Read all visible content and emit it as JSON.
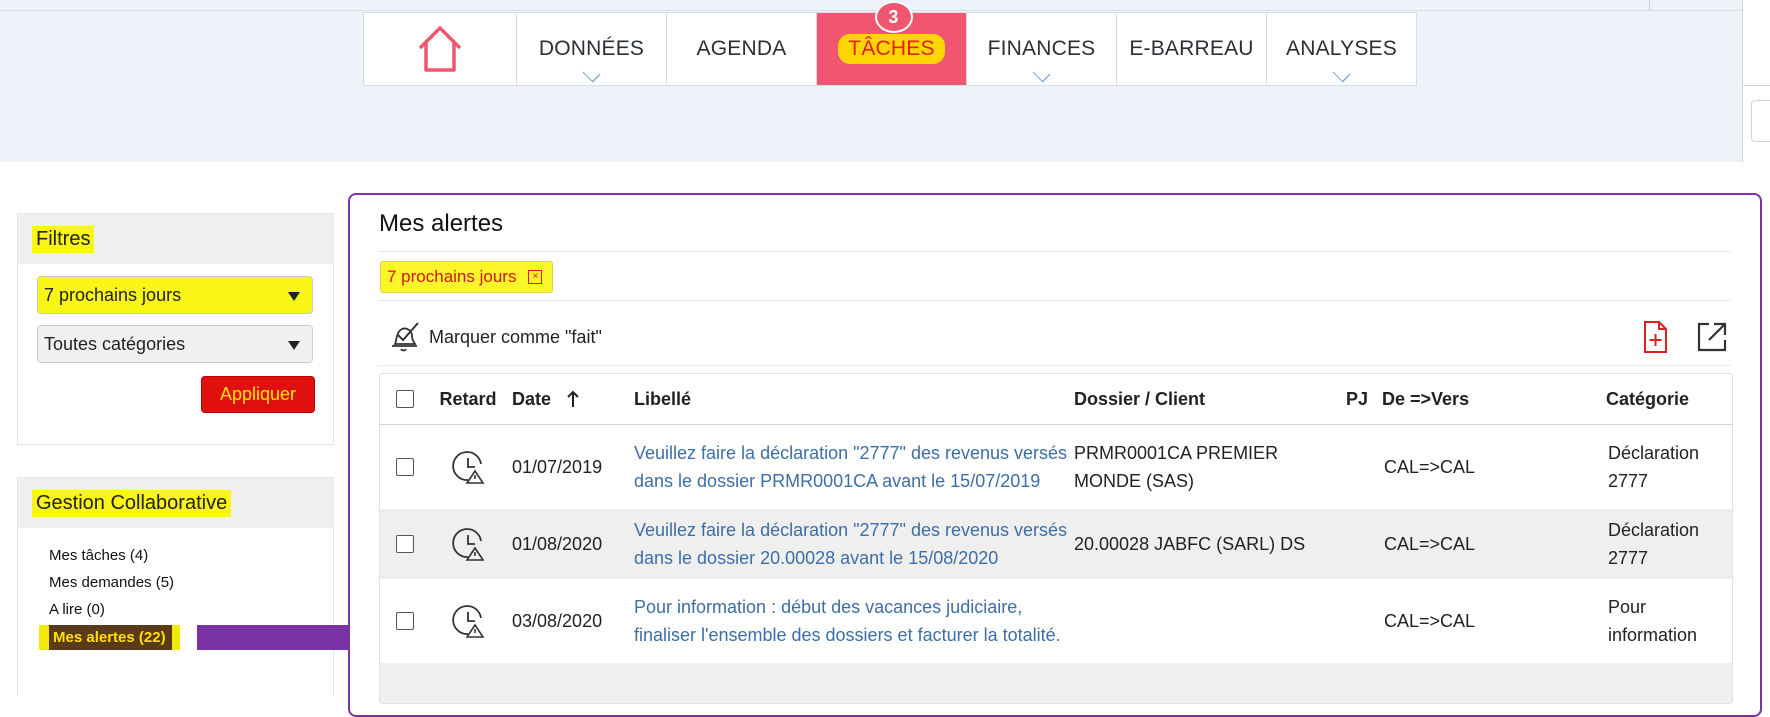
{
  "nav": {
    "home_icon": "home-icon",
    "items": [
      {
        "label": "DONNÉES",
        "has_dropdown": true
      },
      {
        "label": "AGENDA",
        "has_dropdown": false
      },
      {
        "label": "TÂCHES",
        "has_dropdown": false,
        "active": true,
        "badge": "3"
      },
      {
        "label": "FINANCES",
        "has_dropdown": true
      },
      {
        "label": "E-BARREAU",
        "has_dropdown": false
      },
      {
        "label": "ANALYSES",
        "has_dropdown": true
      }
    ]
  },
  "filters": {
    "title": "Filtres",
    "period_select": "7 prochains jours",
    "category_select": "Toutes catégories",
    "apply_label": "Appliquer"
  },
  "collab": {
    "title": "Gestion Collaborative",
    "items": [
      "Mes tâches (4)",
      "Mes demandes (5)",
      "A lire (0)"
    ],
    "active_item": "Mes alertes (22)"
  },
  "main": {
    "title": "Mes alertes",
    "active_filter_chip": "7 prochains jours",
    "mark_done_label": "Marquer comme \"fait\"",
    "columns": {
      "retard": "Retard",
      "date": "Date",
      "libelle": "Libellé",
      "dossier": "Dossier / Client",
      "pj": "PJ",
      "de_vers": "De =>Vers",
      "categorie": "Catégorie"
    },
    "rows": [
      {
        "date": "01/07/2019",
        "libelle": "Veuillez faire la déclaration \"2777\" des revenus versés dans le dossier PRMR0001CA avant le 15/07/2019",
        "dossier": "PRMR0001CA PREMIER MONDE (SAS)",
        "pj": "",
        "de_vers": "CAL=>CAL",
        "categorie": "Déclaration 2777"
      },
      {
        "date": "01/08/2020",
        "libelle": "Veuillez faire la déclaration \"2777\" des revenus versés dans le dossier 20.00028 avant le 15/08/2020",
        "dossier": "20.00028 JABFC (SARL) DS",
        "pj": "",
        "de_vers": "CAL=>CAL",
        "categorie": "Déclaration 2777"
      },
      {
        "date": "03/08/2020",
        "libelle": "Pour information : début des vacances judiciaire, finaliser l'ensemble des dossiers et facturer la totalité.",
        "dossier": "",
        "pj": "",
        "de_vers": "CAL=>CAL",
        "categorie": "Pour information"
      }
    ]
  },
  "colors": {
    "accent_purple": "#7b33a4",
    "active_tab": "#f0566f",
    "apply_button": "#e0100f",
    "highlight_yellow": "#f9f514",
    "link_blue": "#3d6ea6"
  }
}
